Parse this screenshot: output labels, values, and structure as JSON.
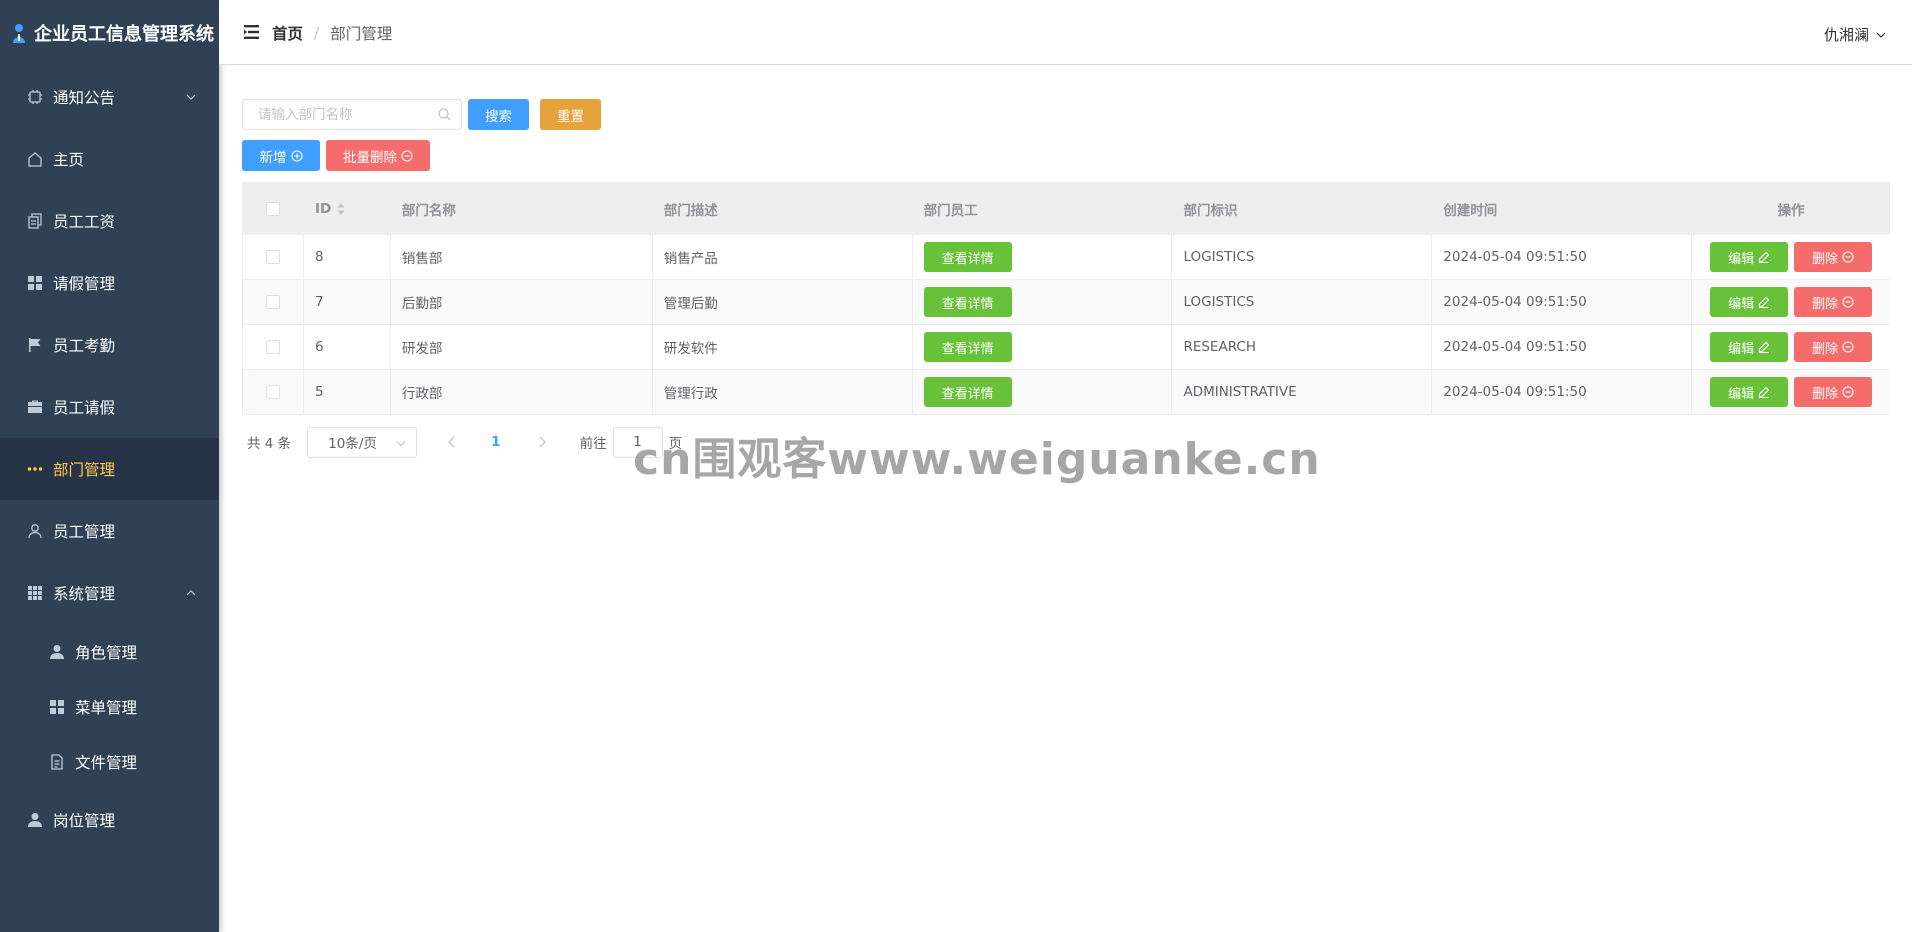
{
  "app": {
    "title": "企业员工信息管理系统"
  },
  "sidebar": {
    "items": [
      {
        "label": "通知公告",
        "icon": "chip-icon",
        "expandable": true,
        "expanded": false
      },
      {
        "label": "主页",
        "icon": "home-icon"
      },
      {
        "label": "员工工资",
        "icon": "copy-document-icon"
      },
      {
        "label": "请假管理",
        "icon": "grid-icon"
      },
      {
        "label": "员工考勤",
        "icon": "flag-icon"
      },
      {
        "label": "员工请假",
        "icon": "briefcase-icon"
      },
      {
        "label": "部门管理",
        "icon": "more-dots-icon",
        "active": true
      },
      {
        "label": "员工管理",
        "icon": "user-outline-icon"
      },
      {
        "label": "系统管理",
        "icon": "menu-grid-icon",
        "expandable": true,
        "expanded": true,
        "children": [
          {
            "label": "角色管理",
            "icon": "user-solid-icon"
          },
          {
            "label": "菜单管理",
            "icon": "grid-icon"
          },
          {
            "label": "文件管理",
            "icon": "document-icon"
          }
        ]
      },
      {
        "label": "岗位管理",
        "icon": "user-solid-icon"
      }
    ]
  },
  "header": {
    "breadcrumb": {
      "home": "首页",
      "separator": "/",
      "current": "部门管理"
    },
    "user_name": "仇湘澜"
  },
  "toolbar": {
    "search_placeholder": "请输入部门名称",
    "search_label": "搜索",
    "reset_label": "重置",
    "add_label": "新增",
    "batch_delete_label": "批量删除"
  },
  "table": {
    "columns": [
      "ID",
      "部门名称",
      "部门描述",
      "部门员工",
      "部门标识",
      "创建时间",
      "操作"
    ],
    "detail_label": "查看详情",
    "edit_label": "编辑",
    "delete_label": "删除",
    "rows": [
      {
        "id": "8",
        "name": "销售部",
        "desc": "销售产品",
        "flag": "LOGISTICS",
        "time": "2024-05-04 09:51:50"
      },
      {
        "id": "7",
        "name": "后勤部",
        "desc": "管理后勤",
        "flag": "LOGISTICS",
        "time": "2024-05-04 09:51:50"
      },
      {
        "id": "6",
        "name": "研发部",
        "desc": "研发软件",
        "flag": "RESEARCH",
        "time": "2024-05-04 09:51:50"
      },
      {
        "id": "5",
        "name": "行政部",
        "desc": "管理行政",
        "flag": "ADMINISTRATIVE",
        "time": "2024-05-04 09:51:50"
      }
    ]
  },
  "pagination": {
    "total_text": "共 4 条",
    "page_size": "10条/页",
    "current_page": "1",
    "goto_prefix": "前往",
    "goto_value": "1",
    "goto_suffix": "页"
  },
  "watermark": "cn围观客www.weiguanke.cn",
  "colors": {
    "sidebar_bg": "#304156",
    "sidebar_active_bg": "#263445",
    "sidebar_active_text": "#ffd04b",
    "primary": "#409eff",
    "warning": "#e6a23c",
    "danger": "#f56c6c",
    "success": "#67c23a"
  }
}
